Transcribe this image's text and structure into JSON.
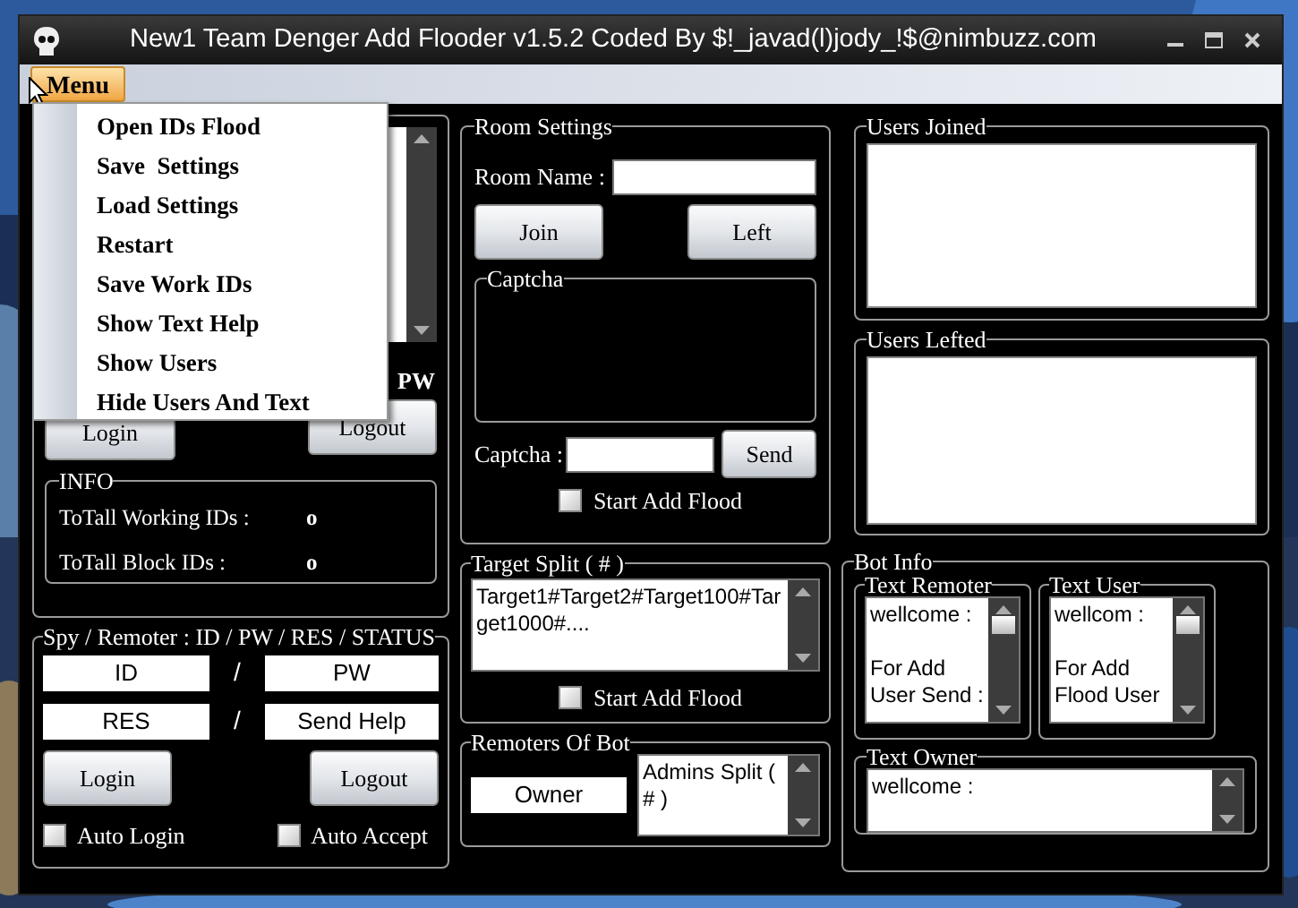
{
  "window": {
    "title": "New1 Team Denger Add Flooder v1.5.2 Coded By $!_javad(l)jody_!$@nimbuzz.com"
  },
  "menu": {
    "label": "Menu",
    "expanded": true,
    "items": [
      {
        "label": "Open IDs Flood"
      },
      {
        "label": "Save  Settings"
      },
      {
        "label": "Load Settings"
      },
      {
        "label": "Restart"
      },
      {
        "label": "Save Work IDs"
      },
      {
        "label": "Show Text Help"
      },
      {
        "label": "Show Users"
      },
      {
        "label": "Hide Users And Text"
      }
    ]
  },
  "account": {
    "pw_label": "PW",
    "login": "Login",
    "logout": "Logout",
    "info": {
      "title": "INFO",
      "rows": [
        {
          "label": "ToTall Working IDs :",
          "value": "o"
        },
        {
          "label": "ToTall Block IDs :",
          "value": "o"
        }
      ]
    }
  },
  "spy": {
    "title": "Spy / Remoter : ID / PW / RES / STATUS",
    "id": "ID",
    "pw": "PW",
    "res": "RES",
    "status": "Send Help",
    "separator": "/",
    "login": "Login",
    "logout": "Logout",
    "checks": [
      {
        "label": "Auto Login",
        "checked": false
      },
      {
        "label": "Auto Accept",
        "checked": false
      }
    ]
  },
  "room": {
    "title": "Room Settings",
    "room_label": "Room Name :",
    "join": "Join",
    "left": "Left",
    "captcha_title": "Captcha",
    "captcha_label": "Captcha :",
    "send": "Send",
    "start": {
      "label": "Start Add Flood",
      "checked": false
    }
  },
  "target": {
    "title": "Target Split ( # )",
    "text": "Target1#Target2#Target100#Target1000#....",
    "start": {
      "label": "Start Add Flood",
      "checked": false
    }
  },
  "remoters": {
    "title": "Remoters Of Bot",
    "owner": "Owner",
    "admins": "Admins Split ( # )"
  },
  "users_joined": {
    "title": "Users Joined"
  },
  "users_lefted": {
    "title": "Users Lefted"
  },
  "bot_info": {
    "title": "Bot Info",
    "text_remoter": {
      "title": "Text Remoter",
      "paragraphs": [
        "wellcome :",
        "For Add\nUser Send :"
      ]
    },
    "text_user": {
      "title": "Text User",
      "paragraphs": [
        "wellcom :",
        "For Add\nFlood User"
      ]
    },
    "text_owner": {
      "title": "Text Owner",
      "paragraphs": [
        "wellcome :"
      ]
    }
  }
}
